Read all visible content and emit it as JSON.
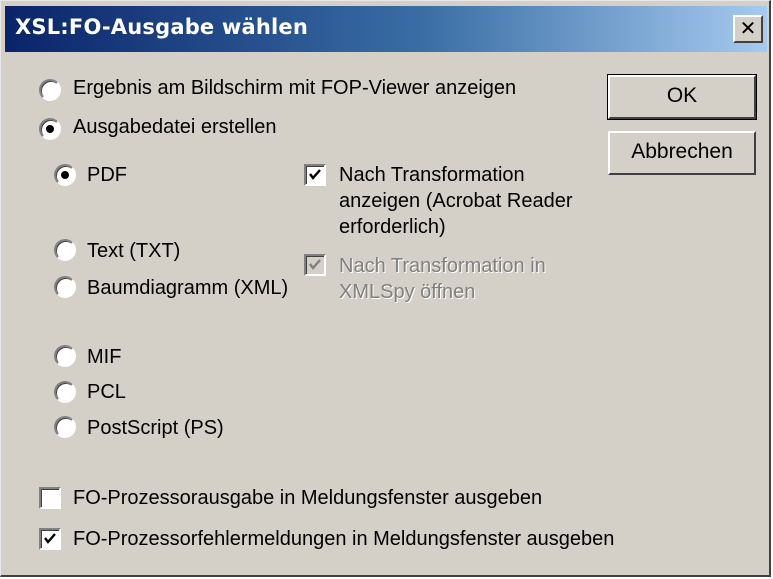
{
  "window": {
    "title": "XSL:FO-Ausgabe wählen",
    "close_glyph": "✕"
  },
  "options": {
    "viewer": "Ergebnis am Bildschirm mit FOP-Viewer anzeigen",
    "file": "Ausgabedatei erstellen"
  },
  "formats": {
    "pdf": "PDF",
    "txt": "Text (TXT)",
    "xml": "Baumdiagramm (XML)",
    "mif": "MIF",
    "pcl": "PCL",
    "ps": "PostScript (PS)"
  },
  "after": {
    "acrobat_line1": "Nach Transformation",
    "acrobat_line2": "anzeigen (Acrobat Reader",
    "acrobat_line3": "erforderlich)",
    "xmlspy_line1": "Nach Transformation in",
    "xmlspy_line2": "XMLSpy öffnen"
  },
  "messages": {
    "output": "FO-Prozessorausgabe in Meldungsfenster ausgeben",
    "errors": "FO-Prozessorfehlermeldungen in Meldungsfenster ausgeben"
  },
  "buttons": {
    "ok": "OK",
    "cancel": "Abbrechen"
  },
  "state": {
    "output_mode": "file",
    "format": "pdf",
    "open_acrobat": true,
    "open_xmlspy": true,
    "xmlspy_disabled": true,
    "show_output": false,
    "show_errors": true
  }
}
